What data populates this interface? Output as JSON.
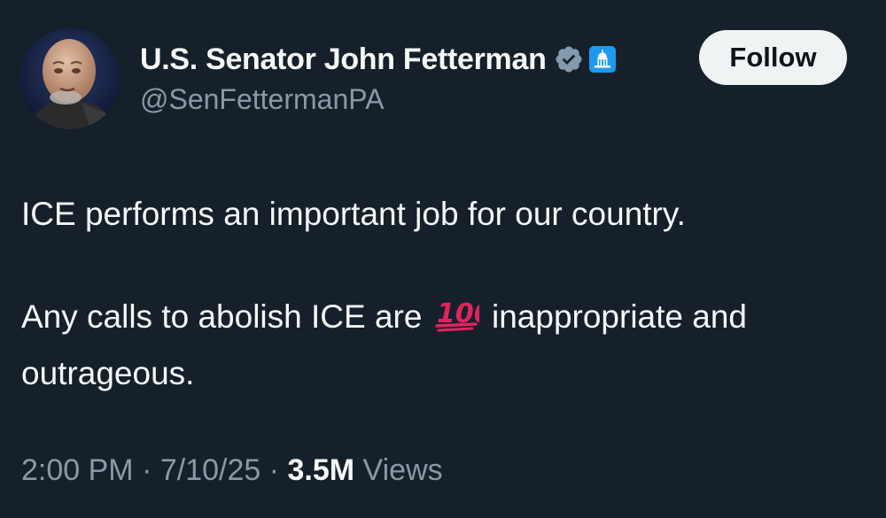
{
  "author": {
    "display_name": "U.S. Senator John Fetterman",
    "handle": "@SenFettermanPA",
    "avatar_icon": "profile-photo",
    "verified_icon": "verified-badge-icon",
    "affiliation_icon": "capitol-dome-icon"
  },
  "follow_button": {
    "label": "Follow"
  },
  "tweet": {
    "line1": "ICE performs an important job for our country.",
    "line2_before": "Any calls to abolish ICE are",
    "emoji_icon": "hundred-points-icon",
    "line2_after": "inappropriate and outrageous."
  },
  "meta": {
    "time": "2:00 PM",
    "sep1": " · ",
    "date": "7/10/25",
    "sep2": " · ",
    "views_count": "3.5M",
    "views_label": " Views"
  },
  "colors": {
    "background": "#15202b",
    "text": "#f7f9f9",
    "secondary_text": "#8b98a5",
    "verified": "#829aab",
    "affiliation": "#1d9bf0",
    "button_bg": "#eff3f4",
    "emoji_red": "#e0245e"
  }
}
